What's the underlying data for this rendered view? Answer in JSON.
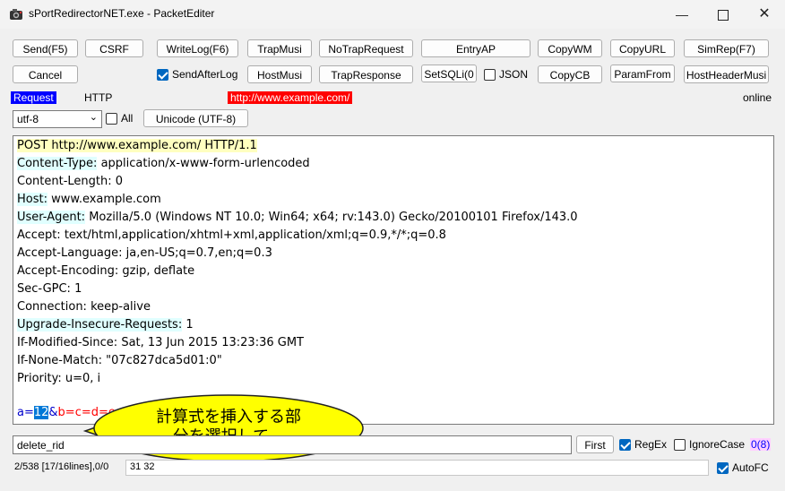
{
  "window": {
    "title": "sPortRedirectorNET.exe - PacketEditer"
  },
  "toolbar": {
    "row1": [
      "Send(F5)",
      "CSRF",
      "WriteLog(F6)",
      "TrapMusi",
      "NoTrapRequest",
      "EntryAP",
      "CopyWM",
      "CopyURL",
      "SimRep(F7)"
    ],
    "row2": [
      "Cancel",
      "HostMusi",
      "TrapResponse",
      "SetSQLi(0",
      "CopyCB",
      "ParamFrom",
      "HostHeaderMusi"
    ],
    "send_after_log": "SendAfterLog",
    "json_label": "JSON"
  },
  "status": {
    "request_badge": "Request",
    "protocol": "HTTP",
    "url": "http://www.example.com/",
    "online": "online"
  },
  "encoding": {
    "selected": "utf-8",
    "all_label": "All",
    "unicode_button": "Unicode (UTF-8)"
  },
  "editor": {
    "lines": [
      {
        "k": "POST http://www.example.com/ HTTP/1.1",
        "v": ""
      },
      {
        "k": "Content-Type:",
        "v": " application/x-www-form-urlencoded"
      },
      {
        "k": "Content-Length:",
        "v": " 0"
      },
      {
        "k": "Host:",
        "v": " www.example.com"
      },
      {
        "k": "User-Agent:",
        "v": " Mozilla/5.0 (Windows NT 10.0; Win64; x64; rv:143.0) Gecko/20100101 Firefox/143.0"
      },
      {
        "k": "Accept:",
        "v": " text/html,application/xhtml+xml,application/xml;q=0.9,*/*;q=0.8"
      },
      {
        "k": "Accept-Language:",
        "v": " ja,en-US;q=0.7,en;q=0.3"
      },
      {
        "k": "Accept-Encoding:",
        "v": " gzip, deflate"
      },
      {
        "k": "Sec-GPC:",
        "v": " 1"
      },
      {
        "k": "Connection:",
        "v": " keep-alive"
      },
      {
        "k": "Upgrade-Insecure-Requests:",
        "v": " 1"
      },
      {
        "k": "If-Modified-Since:",
        "v": " Sat, 13 Jun 2015 13:23:36 GMT"
      },
      {
        "k": "If-None-Match:",
        "v": " \"07c827dca5d01:0\""
      },
      {
        "k": "Priority:",
        "v": " u=0, i"
      }
    ],
    "body": {
      "a_key": "a=",
      "a_val": "12",
      "amp": "&",
      "rest": "b=c=d=e"
    }
  },
  "callout": {
    "line1": "計算式を挿入する部",
    "line2": "分を選択して..."
  },
  "search": {
    "value": "delete_rid",
    "first_button": "First",
    "regex": "RegEx",
    "ignore_case": "IgnoreCase",
    "match_count": "0(8)"
  },
  "statusbar": {
    "position": "2/538 [17/16lines],0/0",
    "hex": "31 32",
    "autofc": "AutoFC"
  },
  "colors": {
    "request_badge": "#0000ff",
    "url_badge": "#ff0000",
    "body_red": "#ff0000",
    "body_blue": "#0000cc",
    "selection": "#0078d7",
    "callout_fill": "#ffff00"
  }
}
